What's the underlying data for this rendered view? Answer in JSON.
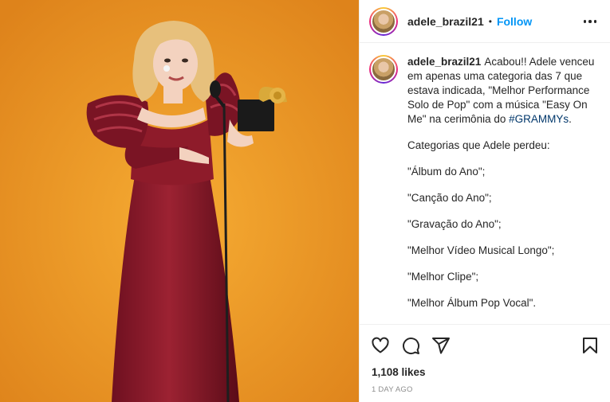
{
  "media": {
    "alt_icon": "photo-of-woman-holding-grammy-award",
    "colors": {
      "background": "#ea9524",
      "dress": "#8e1b2a",
      "skin": "#f3d2bf",
      "hair": "#e7c07c"
    }
  },
  "header": {
    "username": "adele_brazil21",
    "separator": "•",
    "follow_label": "Follow",
    "more_icon": "more-options-icon"
  },
  "caption": {
    "username": "adele_brazil21",
    "lines": [
      "Acabou!! Adele venceu",
      "em apenas uma categoria das 7 que",
      "estava indicada, \"Melhor Performance",
      "Solo de Pop\" com a música \"Easy On",
      "Me\" na cerimônia do "
    ],
    "hashtag": "#GRAMMYs",
    "hashtag_suffix": ".",
    "heading": "Categorias que Adele perdeu:",
    "categories": [
      "\"Álbum do Ano\";",
      "\"Canção do Ano\";",
      "\"Gravação do Ano\";",
      "\"Melhor Vídeo Musical Longo\";",
      "\"Melhor Clipe\";",
      "\"Melhor Álbum Pop Vocal\"."
    ]
  },
  "actions": {
    "like_icon": "heart-icon",
    "comment_icon": "comment-icon",
    "share_icon": "share-icon",
    "save_icon": "bookmark-icon"
  },
  "likes": "1,108 likes",
  "timestamp": "1 DAY AGO",
  "accent_color": "#0095f6"
}
